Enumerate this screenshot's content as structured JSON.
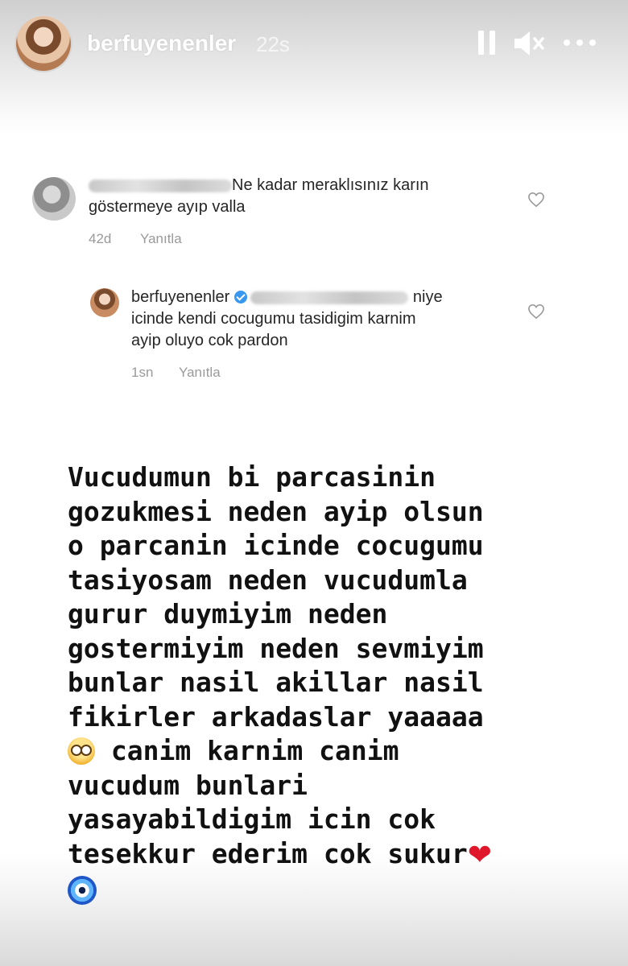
{
  "header": {
    "username": "berfuyenenler",
    "time_ago": "22s",
    "icons": [
      "pause-icon",
      "mute-icon",
      "more-icon"
    ]
  },
  "comment": {
    "text_line1": "Ne kadar meraklısınız karın",
    "text_line2": "göstermeye ayıp valla",
    "age": "42d",
    "reply_label": "Yanıtla"
  },
  "reply": {
    "username": "berfuyenenler",
    "text_line1_end": "niye",
    "text_line2": "icinde kendi cocugumu tasidigim karnim",
    "text_line3": "ayip oluyo cok pardon",
    "age": "1sn",
    "reply_label": "Yanıtla"
  },
  "story_text": {
    "line1": "Vucudumun bi parcasinin",
    "line2": "gozukmesi neden ayip olsun",
    "line3": "o parcanin icinde cocugumu",
    "line4": "tasiyosam neden vucudumla",
    "line5": "gurur duymiyim neden",
    "line6": "gostermiyim neden sevmiyim",
    "line7": "bunlar nasil akillar nasil",
    "line8": "fikirler arkadaslar yaaaaa",
    "line9": " canim karnim canim",
    "line10": "vucudum bunlari",
    "line11": "yasayabildigim icin cok",
    "line12": "tesekkur ederim cok sukur"
  },
  "colors": {
    "verified": "#3897f0",
    "heart_emoji": "#e0162b",
    "text": "#111111",
    "meta": "#9a9a9a"
  }
}
